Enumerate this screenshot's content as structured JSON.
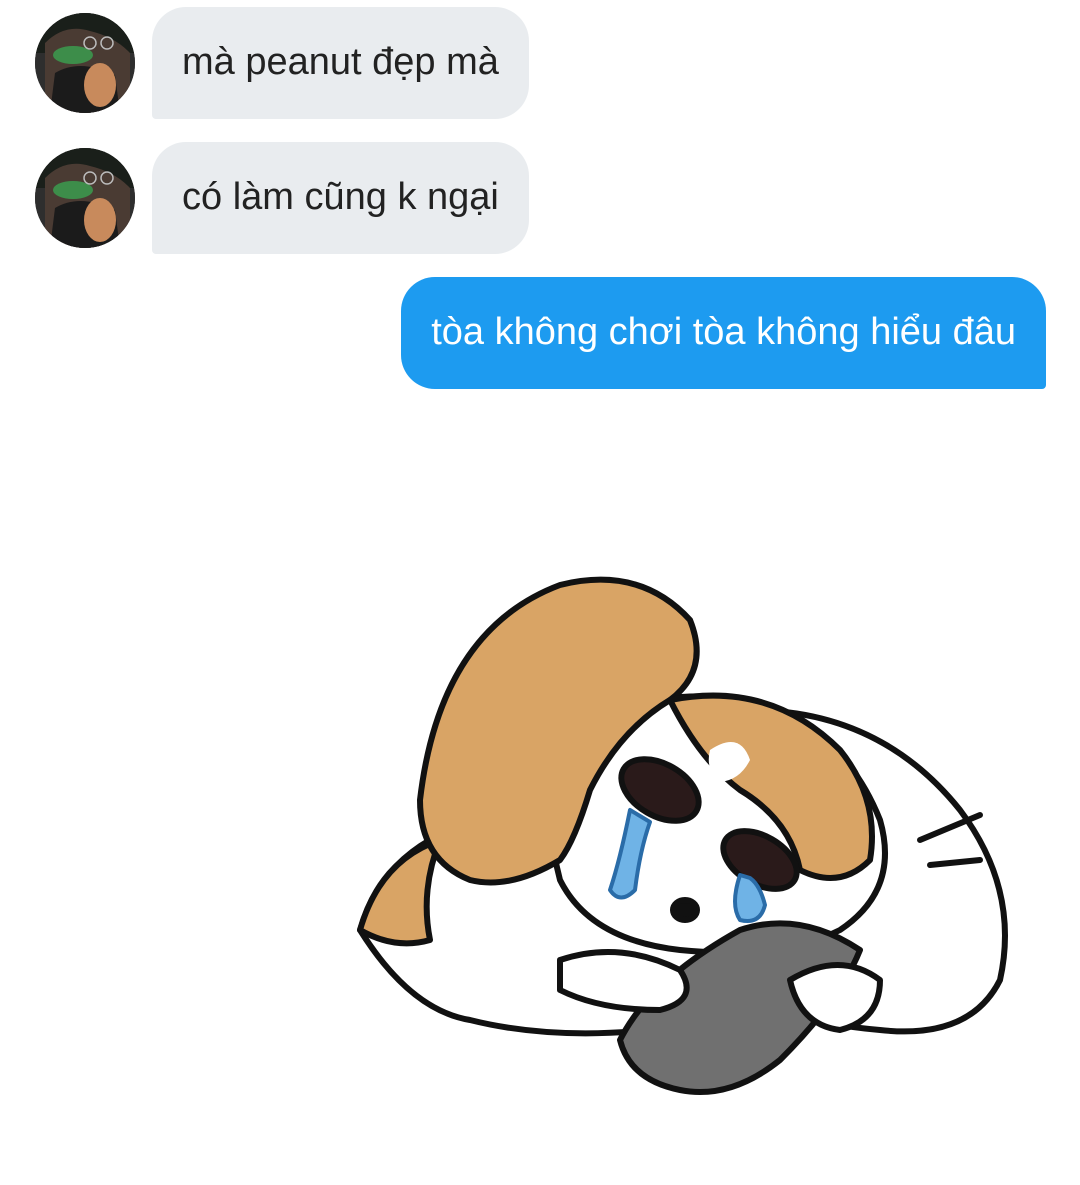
{
  "conversation": {
    "messages": [
      {
        "sender": "other",
        "text": "mà peanut đẹp mà"
      },
      {
        "sender": "other",
        "text": "có làm cũng k ngại"
      },
      {
        "sender": "me",
        "text": "tòa không chơi tòa không hiểu đâu"
      }
    ],
    "sticker": {
      "icon": "crying-dog-with-phone-sticker"
    }
  },
  "colors": {
    "incoming_bubble": "#e9ecef",
    "outgoing_bubble": "#1d9bf0",
    "background": "#ffffff"
  }
}
